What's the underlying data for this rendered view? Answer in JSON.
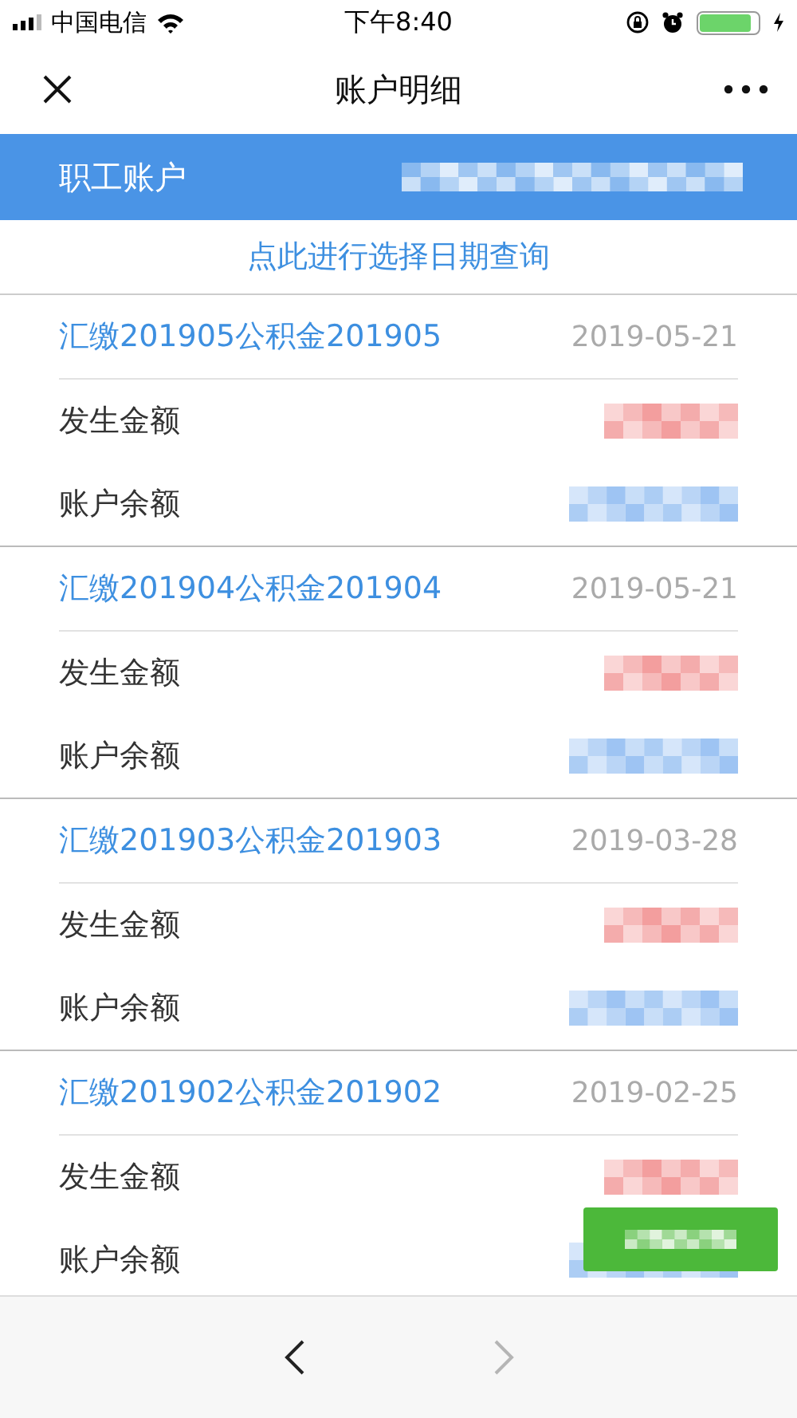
{
  "status_bar": {
    "carrier": "中国电信",
    "time": "下午8:40"
  },
  "nav": {
    "title": "账户明细"
  },
  "account_bar": {
    "label": "职工账户"
  },
  "date_query_link": "点此进行选择日期查询",
  "records": [
    {
      "title": "汇缴201905公积金201905",
      "date": "2019-05-21",
      "rows": [
        {
          "kind": "amount",
          "label": "发生金额"
        },
        {
          "kind": "balance",
          "label": "账户余额"
        }
      ]
    },
    {
      "title": "汇缴201904公积金201904",
      "date": "2019-05-21",
      "rows": [
        {
          "kind": "amount",
          "label": "发生金额"
        },
        {
          "kind": "balance",
          "label": "账户余额"
        }
      ]
    },
    {
      "title": "汇缴201903公积金201903",
      "date": "2019-03-28",
      "rows": [
        {
          "kind": "amount",
          "label": "发生金额"
        },
        {
          "kind": "balance",
          "label": "账户余额"
        }
      ]
    },
    {
      "title": "汇缴201902公积金201902",
      "date": "2019-02-25",
      "rows": [
        {
          "kind": "amount",
          "label": "发生金额"
        },
        {
          "kind": "balance",
          "label": "账户余额"
        }
      ]
    }
  ],
  "bottom_bar": {
    "back_enabled": true,
    "forward_enabled": false
  }
}
